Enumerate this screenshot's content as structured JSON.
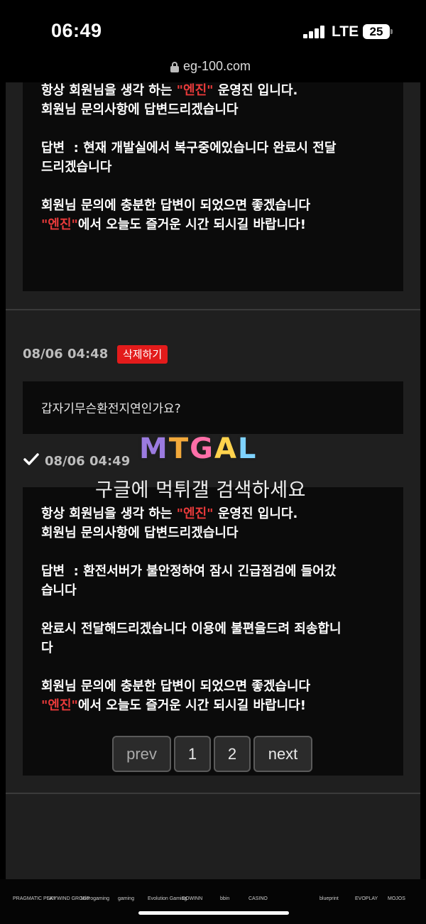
{
  "status": {
    "time": "06:49",
    "network": "LTE",
    "battery": "25"
  },
  "browser": {
    "url": "eg-100.com"
  },
  "reply1": {
    "lines": [
      [
        {
          "t": "항상 회원님을 생각 하는 "
        },
        {
          "t": "\"엔진\"",
          "red": true
        },
        {
          "t": " 운영진 입니다."
        }
      ],
      [
        {
          "t": "회원님 문의사항에 답변드리겠습니다"
        }
      ],
      [
        {
          "t": ""
        }
      ],
      [
        {
          "t": "답변  : 현재 개발실에서 복구중에있습니다 완료시 전달"
        }
      ],
      [
        {
          "t": "드리겠습니다"
        }
      ],
      [
        {
          "t": ""
        }
      ],
      [
        {
          "t": "회원님 문의에 충분한 답변이 되었으면 좋겠습니다"
        }
      ],
      [
        {
          "t": "\"엔진\"",
          "red": true
        },
        {
          "t": "에서 오늘도 즐거운 시간 되시길 바랍니다!"
        }
      ]
    ]
  },
  "post": {
    "question_time": "08/06 04:48",
    "delete_label": "삭제하기",
    "question": "갑자기무슨환전지연인가요?",
    "answer_time": "08/06 04:49"
  },
  "watermark": {
    "logo": "MTGAL",
    "text": "구글에 먹튀갤 검색하세요"
  },
  "reply2": {
    "lines": [
      [
        {
          "t": "항상 회원님을 생각 하는 "
        },
        {
          "t": "\"엔진\"",
          "red": true
        },
        {
          "t": " 운영진 입니다."
        }
      ],
      [
        {
          "t": "회원님 문의사항에 답변드리겠습니다"
        }
      ],
      [
        {
          "t": ""
        }
      ],
      [
        {
          "t": "답변  : 환전서버가 불안정하여 잠시 긴급점검에 들어갔"
        }
      ],
      [
        {
          "t": "습니다"
        }
      ],
      [
        {
          "t": ""
        }
      ],
      [
        {
          "t": "완료시 전달해드리겠습니다 이용에 불편을드려 죄송합니"
        }
      ],
      [
        {
          "t": "다"
        }
      ],
      [
        {
          "t": ""
        }
      ],
      [
        {
          "t": "회원님 문의에 충분한 답변이 되었으면 좋겠습니다"
        }
      ],
      [
        {
          "t": "\"엔진\"",
          "red": true
        },
        {
          "t": "에서 오늘도 즐거운 시간 되시길 바랍니다!"
        }
      ]
    ]
  },
  "pagination": {
    "prev": "prev",
    "page1": "1",
    "page2": "2",
    "next": "next"
  },
  "footer": {
    "providers": [
      "PRAGMATIC PLAY",
      "SKYWIND GROUP",
      "Microgaming",
      "gaming",
      "Evolution Gaming",
      "DOWINN",
      "bbin",
      "CASINO",
      "",
      "blueprint",
      "EVOPLAY",
      "MOJOS"
    ]
  }
}
